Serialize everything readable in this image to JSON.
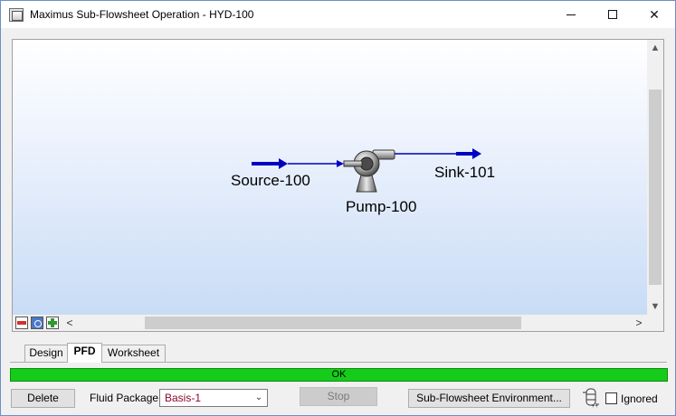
{
  "window": {
    "title": "Maximus Sub-Flowsheet Operation - HYD-100",
    "controls": {
      "minimize_icon": "minimize-icon",
      "maximize_icon": "maximize-icon",
      "close_icon": "close-icon",
      "close_glyph": "✕"
    }
  },
  "pfd": {
    "source_label": "Source-100",
    "pump_label": "Pump-100",
    "sink_label": "Sink-101",
    "stream_color": "#0000c0",
    "scroll_up": "▲",
    "scroll_down": "▼",
    "scroll_left": "<",
    "scroll_right": ">"
  },
  "tabs": [
    {
      "label": "Design",
      "active": false
    },
    {
      "label": "PFD",
      "active": true
    },
    {
      "label": "Worksheet",
      "active": false
    }
  ],
  "status": {
    "text": "OK",
    "color": "#16cc1a"
  },
  "footer": {
    "delete_label": "Delete",
    "fluid_package_label": "Fluid Package",
    "fluid_package_value": "Basis-1",
    "select_arrow": "⌄",
    "stop_label": "Stop",
    "subflowsheet_label": "Sub-Flowsheet Environment...",
    "ignored_label": "Ignored",
    "ignored_checked": false
  }
}
